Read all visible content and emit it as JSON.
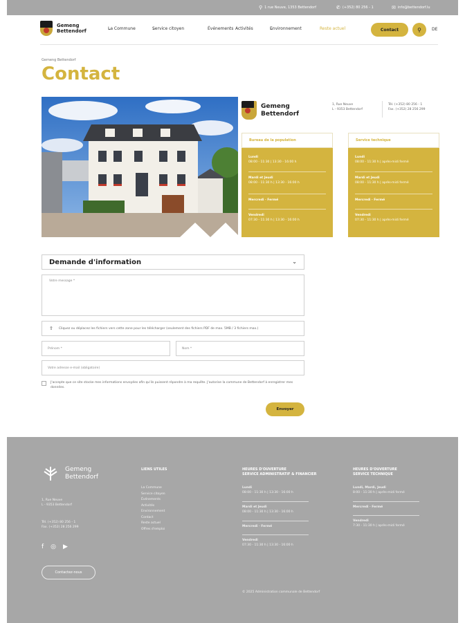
{
  "topbar": {
    "address": "1 rue Neuve, 1353 Bettendorf",
    "phone": "(+352) 80 256 - 1",
    "email": "info@bettendorf.lu"
  },
  "logo": {
    "line1": "Gemeng",
    "line2": "Bettendorf"
  },
  "nav": {
    "items": [
      {
        "label": "La Commune",
        "chevron": true
      },
      {
        "label": "Service citoyen",
        "chevron": true
      },
      {
        "label": "Événements",
        "chevron": false
      },
      {
        "label": "Activités",
        "chevron": false
      },
      {
        "label": "Environnement",
        "chevron": true
      },
      {
        "label": "Reste actuel",
        "chevron": false
      }
    ],
    "contact_label": "Contact",
    "lang_label": "DE"
  },
  "breadcrumb": "Gemeng Bettendorf",
  "page_title": "Contact",
  "info_card": {
    "name_line1": "Gemeng",
    "name_line2": "Bettendorf",
    "address_line1": "1, Rue Neuve",
    "address_line2": "L - 9353 Bettendorf",
    "tel": "Tél. (+352) 80 256 - 1",
    "fax": "Fax. (+352) 28 256 299"
  },
  "hours": [
    {
      "title": "Bureau de la population",
      "rows": [
        {
          "day": "Lundi",
          "time": "08:00 - 11:30 | 13:30 - 16:00 h"
        },
        {
          "day": "Mardi et Jeudi",
          "time": "08:00 - 11:30 h | 13:30 - 16:00 h"
        },
        {
          "day": "Mercredi · Fermé",
          "time": ""
        },
        {
          "day": "Vendredi",
          "time": "07:30 - 11:30 h | 13:30 - 16:00 h"
        }
      ]
    },
    {
      "title": "Service technique",
      "rows": [
        {
          "day": "Lundi",
          "time": "08:00 - 11:30 h | après-midi fermé"
        },
        {
          "day": "Mardi et Jeudi",
          "time": "08:00 - 11:30 h | après-midi fermé"
        },
        {
          "day": "Mercredi · Fermé",
          "time": ""
        },
        {
          "day": "Vendredi",
          "time": "07:30 - 11:30 h | après-midi fermé"
        }
      ]
    }
  ],
  "form": {
    "select_label": "Demande d'information",
    "message_placeholder": "Votre message *",
    "upload_text": "Cliquez ou déplacez les fichiers vers cette zone pour les télécharger (seulement des fichiers PDF de max. 5MB / 3 fichiers max.)",
    "firstname_placeholder": "Prénom *",
    "lastname_placeholder": "Nom *",
    "email_placeholder": "Votre adresse e-mail (obligatoire)",
    "consent_text": "J'accepte que ce site stocke mes informations envoyées afin qu'ils puissent répondre à ma requête. J'autorise la commune de Bettendorf à enregistrer mes données.",
    "submit_label": "Envoyer"
  },
  "footer": {
    "logo_line1": "Gemeng",
    "logo_line2": "Bettendorf",
    "address_line1": "1, Rue Neuve",
    "address_line2": "L - 9353 Bettendorf",
    "tel": "Tél. (+352) 80 256 - 1",
    "fax": "Fax. (+352) 28 256 299",
    "contact_button": "Contactez-nous",
    "links_title": "LIENS UTILES",
    "links": [
      "La Commune",
      "Service citoyen",
      "Événements",
      "Activités",
      "Environnement",
      "Contact",
      "Reste actuel",
      "Offres d'emploi"
    ],
    "admin_title_line1": "HEURES D'OUVERTURE",
    "admin_title_line2": "SERVICE ADMINISTRATIF & FINANCIER",
    "admin_rows": [
      {
        "day": "Lundi",
        "time": "08:00 - 11:30 h | 13:30 - 16:00 h"
      },
      {
        "day": "Mardi et Jeudi",
        "time": "08:00 - 11:30 h | 13:30 - 16:00 h"
      },
      {
        "day": "Mercredi · Fermé",
        "time": ""
      },
      {
        "day": "Vendredi",
        "time": "07:30 - 11:30 h | 13:30 - 16:00 h"
      }
    ],
    "tech_title_line1": "HEURES D'OUVERTURE",
    "tech_title_line2": "SERVICE TECHNIQUE",
    "tech_rows": [
      {
        "day": "Lundi, Mardi, Jeudi",
        "time": "8:00 - 11:30 h | après-midi fermé"
      },
      {
        "day": "Mercredi · Fermé",
        "time": ""
      },
      {
        "day": "Vendredi",
        "time": "7:30 - 11:30 h | après-midi fermé"
      }
    ],
    "copyright": "© 2025 Administration communale de Bettendorf"
  },
  "colors": {
    "accent": "#d4b43f",
    "topbar": "#a7a7a7",
    "footer": "#a7a7a7"
  }
}
